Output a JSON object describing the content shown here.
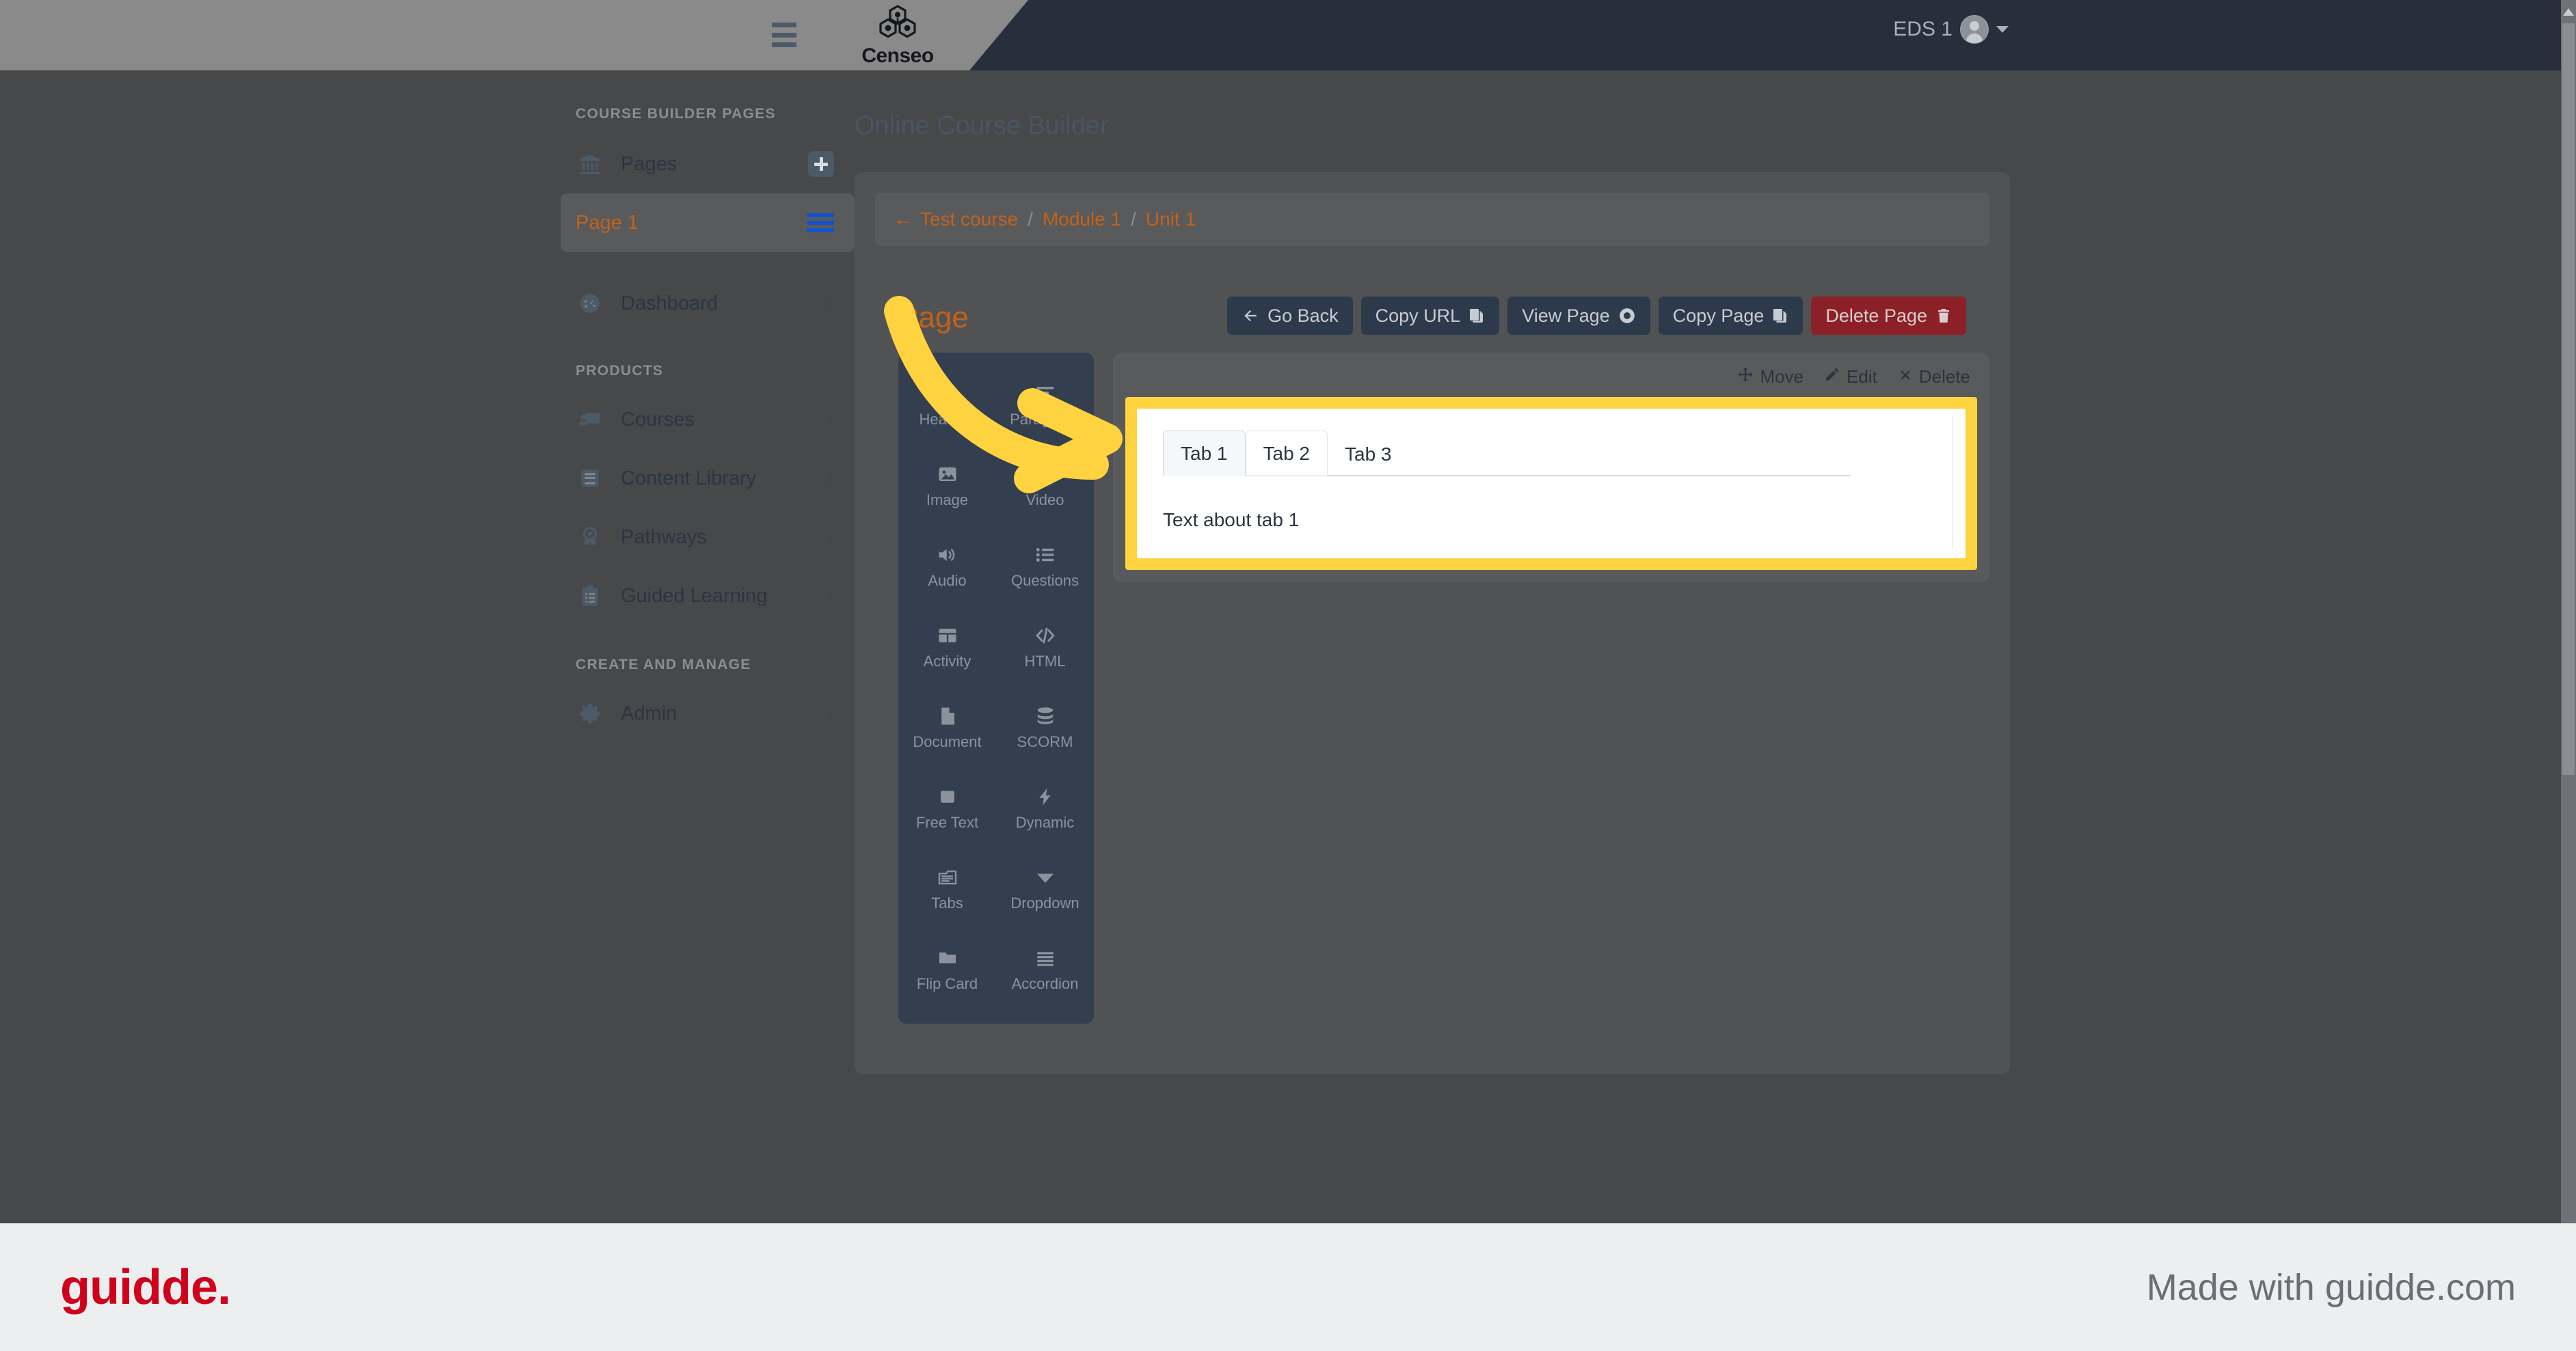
{
  "topbar": {
    "menu_icon": "hamburger-icon",
    "brand_name": "Censeo",
    "brand_logo_icon": "censeo-hexagon-logo",
    "user_name": "EDS 1",
    "avatar_icon": "user-avatar-icon",
    "caret_icon": "chevron-down-icon"
  },
  "sidebar": {
    "sections": [
      {
        "title": "COURSE BUILDER PAGES",
        "items": [
          {
            "label": "Pages",
            "icon": "bank-icon",
            "action_icon": "plus-square-icon",
            "active": false,
            "accent": false
          },
          {
            "label": "Page 1",
            "icon": "none",
            "action_icon": "menu-lines-icon",
            "active": true,
            "accent": true
          },
          {
            "label": "Dashboard",
            "icon": "gauge-icon",
            "action_icon": "chevron-right-icon",
            "active": false,
            "accent": false
          }
        ]
      },
      {
        "title": "PRODUCTS",
        "items": [
          {
            "label": "Courses",
            "icon": "courses-icon",
            "action_icon": "chevron-right-icon",
            "active": false,
            "accent": false
          },
          {
            "label": "Content Library",
            "icon": "book-icon",
            "action_icon": "chevron-right-icon",
            "active": false,
            "accent": false
          },
          {
            "label": "Pathways",
            "icon": "award-icon",
            "action_icon": "chevron-right-icon",
            "active": false,
            "accent": false
          },
          {
            "label": "Guided Learning",
            "icon": "clipboard-icon",
            "action_icon": "chevron-right-icon",
            "active": false,
            "accent": false
          }
        ]
      },
      {
        "title": "CREATE AND MANAGE",
        "items": [
          {
            "label": "Admin",
            "icon": "gear-icon",
            "action_icon": "chevron-right-icon",
            "active": false,
            "accent": false
          }
        ]
      }
    ]
  },
  "main": {
    "page_title": "Online Course Builder",
    "breadcrumb": {
      "back_icon": "arrow-left-icon",
      "items": [
        "Test course",
        "Module 1",
        "Unit 1"
      ],
      "separator": "/"
    },
    "section_title": "Page",
    "buttons": [
      {
        "label": "Go Back",
        "icon": "arrow-left-icon",
        "icon_side": "left",
        "style": "dark"
      },
      {
        "label": "Copy URL",
        "icon": "copy-icon",
        "icon_side": "right",
        "style": "dark"
      },
      {
        "label": "View Page",
        "icon": "eye-icon",
        "icon_side": "right",
        "style": "dark"
      },
      {
        "label": "Copy Page",
        "icon": "copy-icon",
        "icon_side": "right",
        "style": "dark"
      },
      {
        "label": "Delete Page",
        "icon": "trash-icon",
        "icon_side": "right",
        "style": "danger"
      }
    ],
    "palette": [
      {
        "label": "Heading",
        "icon": "heading-a-icon"
      },
      {
        "label": "Paragraph",
        "icon": "paragraph-lines-icon"
      },
      {
        "label": "Image",
        "icon": "image-icon"
      },
      {
        "label": "Video",
        "icon": "video-play-icon"
      },
      {
        "label": "Audio",
        "icon": "audio-speaker-icon"
      },
      {
        "label": "Questions",
        "icon": "list-bullet-icon"
      },
      {
        "label": "Activity",
        "icon": "table-grid-icon"
      },
      {
        "label": "HTML",
        "icon": "code-brackets-icon"
      },
      {
        "label": "Document",
        "icon": "document-page-icon"
      },
      {
        "label": "SCORM",
        "icon": "database-stack-icon"
      },
      {
        "label": "Free Text",
        "icon": "square-icon"
      },
      {
        "label": "Dynamic",
        "icon": "lightning-bolt-icon"
      },
      {
        "label": "Tabs",
        "icon": "tabs-folder-icon"
      },
      {
        "label": "Dropdown",
        "icon": "triangle-down-icon"
      },
      {
        "label": "Flip Card",
        "icon": "folder-icon"
      },
      {
        "label": "Accordion",
        "icon": "accordion-lines-icon"
      }
    ],
    "widget_toolbar": [
      {
        "label": "Move",
        "icon": "move-arrows-icon"
      },
      {
        "label": "Edit",
        "icon": "pencil-icon"
      },
      {
        "label": "Delete",
        "icon": "close-x-icon"
      }
    ],
    "tabs_widget": {
      "highlighted": true,
      "highlight_color": "#FFD23F",
      "tabs": [
        {
          "label": "Tab 1",
          "state": "active"
        },
        {
          "label": "Tab 2",
          "state": "hover"
        },
        {
          "label": "Tab 3",
          "state": "normal"
        }
      ],
      "body_text": "Text about tab 1"
    }
  },
  "colors": {
    "header_dark": "#272f3d",
    "accent_orange": "#c2621a",
    "highlight_yellow": "#FFD23F",
    "btn_dark": "#2c3a4c",
    "btn_danger": "#8b2027",
    "palette_bg": "#333f4f",
    "guidde_red": "#d0021b"
  },
  "footer": {
    "logo_text": "guidde.",
    "made_with": "Made with guidde.com"
  }
}
